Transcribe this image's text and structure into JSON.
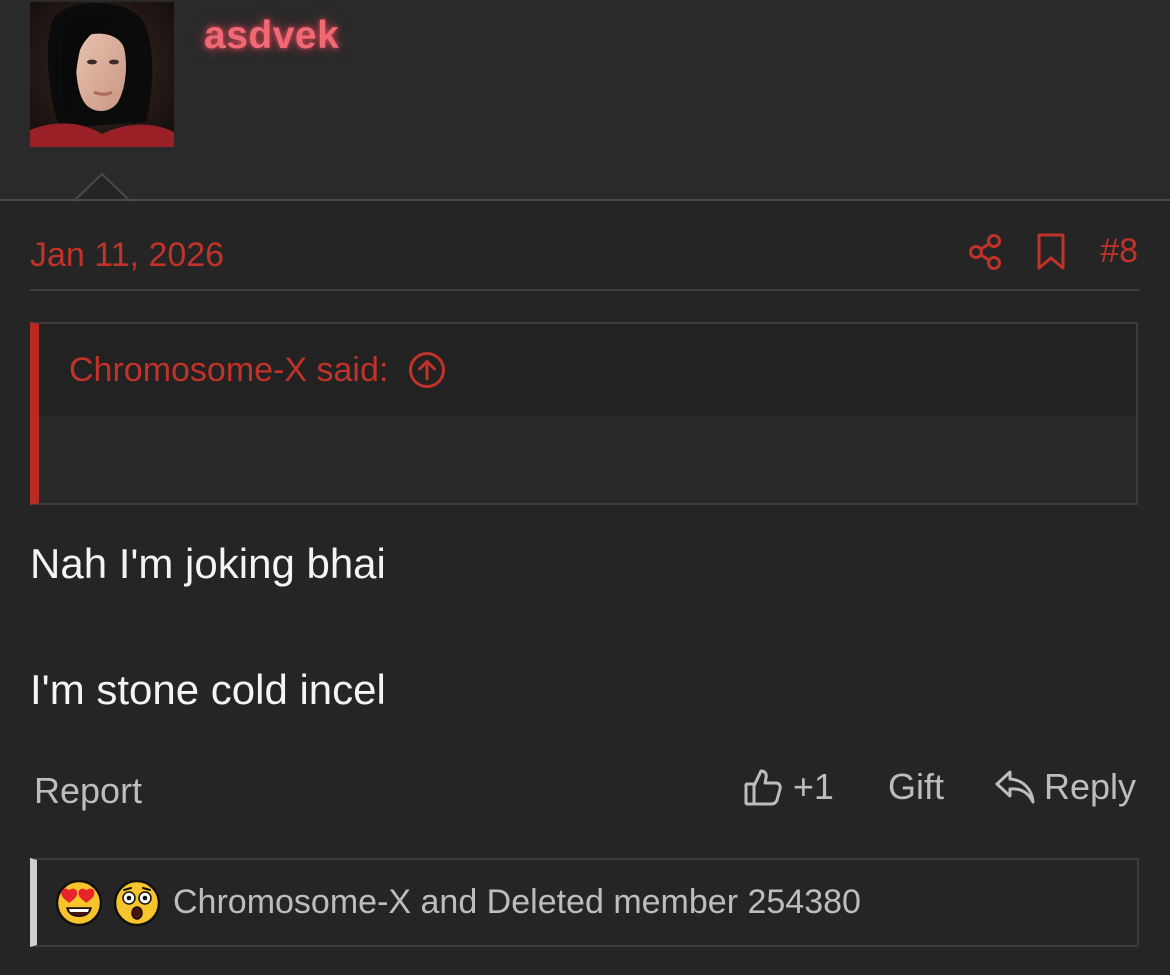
{
  "user": {
    "name": "asdvek",
    "avatar_icon": "avatar-photo"
  },
  "post": {
    "date": "Jan 11, 2026",
    "number": "#8",
    "share_icon": "share-icon",
    "bookmark_icon": "bookmark-icon"
  },
  "quote": {
    "attribution": "Chromosome-X said:",
    "jump_icon": "arrow-up-circle-icon"
  },
  "message": {
    "lines": [
      "Nah I'm joking bhai",
      "I'm stone cold incel"
    ]
  },
  "actions": {
    "report": "Report",
    "like_count": "+1",
    "gift": "Gift",
    "reply": "Reply"
  },
  "reactions": {
    "text": "Chromosome-X and Deleted member 254380",
    "icons": [
      "heart-eyes-emoji",
      "astonished-emoji"
    ]
  },
  "colors": {
    "accent": "#c0322a",
    "username_glow": "#f06a75",
    "background": "#252525",
    "text": "#f4f4f4",
    "muted": "#bdbdbd"
  }
}
